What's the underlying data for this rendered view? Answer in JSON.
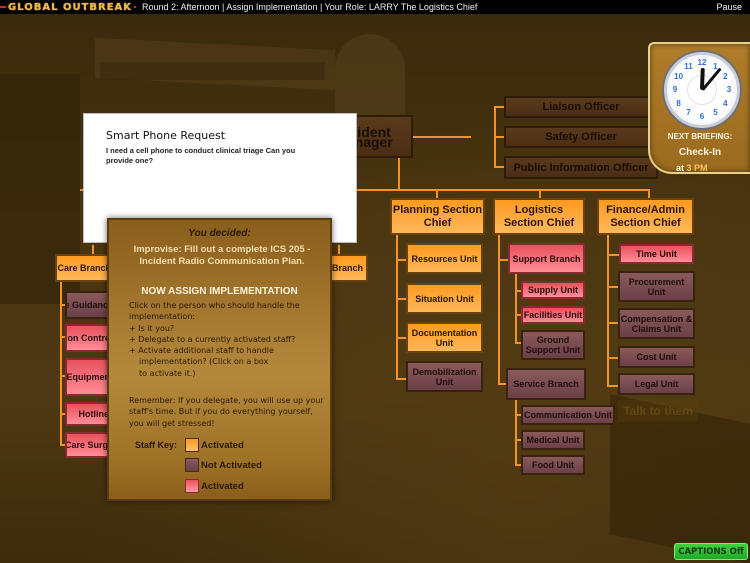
{
  "topbar": {
    "logo": "GLOBAL OUTBREAK",
    "round_info": "Round 2: Afternoon | Assign Implementation | Your Role: LARRY The Logistics  Chief",
    "pause_label": "Pause"
  },
  "clock": {
    "numbers": [
      "12",
      "1",
      "2",
      "3",
      "4",
      "5",
      "6",
      "7",
      "8",
      "9",
      "10",
      "11"
    ],
    "time_shown": "12:58",
    "next_briefing_label": "NEXT BRIEFING:",
    "briefing_name": "Check-In",
    "at_label": "at",
    "briefing_time": "3 PM"
  },
  "request": {
    "title": "Smart Phone Request",
    "body": "I need a cell phone to conduct clinical triage  Can you provide one?"
  },
  "decision": {
    "you_decided": "You decided:",
    "choice": "Improvise: Fill out a complete ICS 205 - Incident Radio Communication Plan.",
    "assign_heading": "NOW ASSIGN IMPLEMENTATION",
    "instructions": [
      "Click on the person who should handle the implementation:",
      "+ Is it you?",
      "+ Delegate to a currently activated staff?",
      "+ Activate additional staff to handle",
      "implementation? (Click on a box",
      "to activate it.)"
    ],
    "remember": "Remember: If you delegate, you will use up your staff's time.  But if you do everything yourself, you will get stressed!",
    "staff_key_label": "Staff Key:",
    "staff_key": [
      {
        "label": "Activated",
        "status": "activated"
      },
      {
        "label": "Not Activated",
        "status": "not-activated"
      },
      {
        "label": "Activated",
        "status": "activated-pink"
      }
    ]
  },
  "org_chart": {
    "incident_manager": "Incident Manager",
    "command_staff": [
      "Liaison Officer",
      "Safety Officer",
      "Public Information Officer"
    ],
    "sections": [
      {
        "name": "Planning Section Chief",
        "status": "activated",
        "units": [
          {
            "name": "Resources Unit",
            "status": "activated"
          },
          {
            "name": "Situation Unit",
            "status": "activated"
          },
          {
            "name": "Documentation Unit",
            "status": "activated"
          },
          {
            "name": "Demobilization Unit",
            "status": "not-activated"
          }
        ]
      },
      {
        "name": "Logistics Section Chief",
        "status": "activated",
        "branches": [
          {
            "name": "Support Branch",
            "status": "activated-pink",
            "units": [
              {
                "name": "Supply Unit",
                "status": "activated-pink"
              },
              {
                "name": "Facilities Unit",
                "status": "activated-pink"
              },
              {
                "name": "Ground Support Unit",
                "status": "not-activated"
              }
            ]
          },
          {
            "name": "Service Branch",
            "status": "not-activated",
            "units": [
              {
                "name": "Communication Unit",
                "status": "not-activated"
              },
              {
                "name": "Medical Unit",
                "status": "not-activated"
              },
              {
                "name": "Food Unit",
                "status": "not-activated"
              }
            ]
          }
        ]
      },
      {
        "name": "Finance/Admin Section Chief",
        "status": "activated",
        "units": [
          {
            "name": "Time Unit",
            "status": "activated-pink"
          },
          {
            "name": "Procurement Unit",
            "status": "not-activated"
          },
          {
            "name": "Compensation & Claims Unit",
            "status": "not-activated"
          },
          {
            "name": "Cost Unit",
            "status": "not-activated"
          },
          {
            "name": "Legal Unit",
            "status": "not-activated"
          }
        ]
      }
    ],
    "operations": {
      "visible_branch": "Branch",
      "health_care_branch": "Health Care Branch",
      "health_units": [
        {
          "name": "Clinical Care Guidance",
          "status": "not-activated"
        },
        {
          "name": "Infection Control",
          "status": "activated-pink"
        },
        {
          "name": "Personal Protective Equipment",
          "status": "activated-pink"
        },
        {
          "name": "Hotline",
          "status": "activated-pink"
        },
        {
          "name": "Health Care Surge",
          "status": "activated-pink"
        }
      ]
    }
  },
  "talk_label": "Talk to them",
  "captions_label": "CAPTIONS Off"
}
